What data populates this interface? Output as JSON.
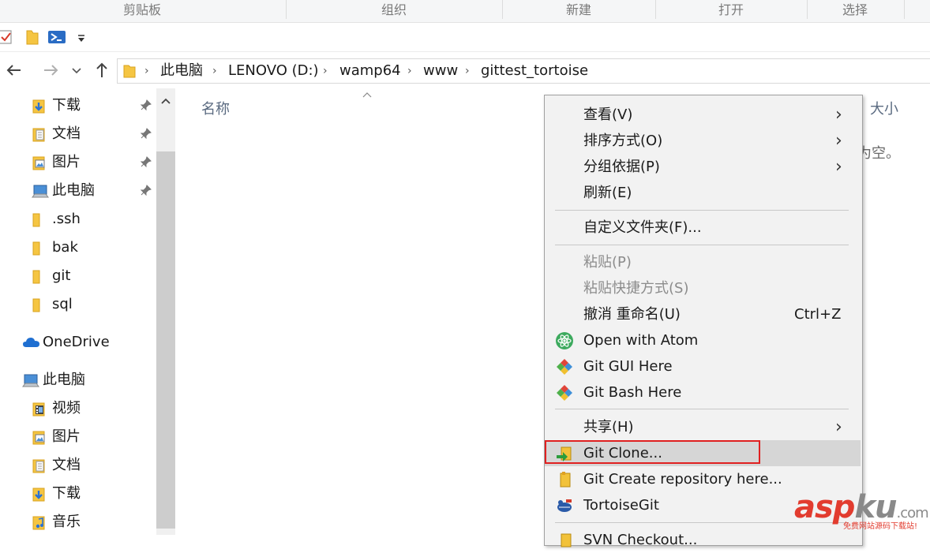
{
  "ribbon": {
    "groups": [
      "剪贴板",
      "组织",
      "新建",
      "打开",
      "选择"
    ]
  },
  "address": {
    "crumbs": [
      "此电脑",
      "LENOVO (D:)",
      "wamp64",
      "www",
      "gittest_tortoise"
    ]
  },
  "sidebar": {
    "quick_access": [
      {
        "label": "下载",
        "icon": "download-folder-icon",
        "pinned": true
      },
      {
        "label": "文档",
        "icon": "documents-folder-icon",
        "pinned": true
      },
      {
        "label": "图片",
        "icon": "pictures-folder-icon",
        "pinned": true
      },
      {
        "label": "此电脑",
        "icon": "this-pc-icon",
        "pinned": true
      },
      {
        "label": ".ssh",
        "icon": "folder-icon",
        "pinned": false
      },
      {
        "label": "bak",
        "icon": "folder-icon",
        "pinned": false
      },
      {
        "label": "git",
        "icon": "folder-icon",
        "pinned": false
      },
      {
        "label": "sql",
        "icon": "folder-icon",
        "pinned": false
      }
    ],
    "onedrive": "OneDrive",
    "this_pc": "此电脑",
    "this_pc_items": [
      {
        "label": "视频",
        "icon": "videos-folder-icon"
      },
      {
        "label": "图片",
        "icon": "pictures-folder-icon"
      },
      {
        "label": "文档",
        "icon": "documents-folder-icon"
      },
      {
        "label": "下载",
        "icon": "download-folder-icon"
      },
      {
        "label": "音乐",
        "icon": "music-folder-icon"
      }
    ]
  },
  "main": {
    "col_name": "名称",
    "col_size": "大小",
    "empty_text": "此文件夹为空。"
  },
  "context_menu": {
    "view": "查看(V)",
    "sort": "排序方式(O)",
    "group": "分组依据(P)",
    "refresh": "刷新(E)",
    "customize": "自定义文件夹(F)...",
    "paste": "粘贴(P)",
    "paste_shortcut": "粘贴快捷方式(S)",
    "undo_rename": "撤消 重命名(U)",
    "undo_shortcut": "Ctrl+Z",
    "open_atom": "Open with Atom",
    "git_gui": "Git GUI Here",
    "git_bash": "Git Bash Here",
    "share": "共享(H)",
    "git_clone": "Git Clone...",
    "git_create": "Git Create repository here...",
    "tortoisegit": "TortoiseGit",
    "svn_checkout": "SVN Checkout..."
  },
  "watermark": {
    "brand_a": "asp",
    "brand_b": "ku",
    "brand_c": ".com",
    "tagline": "免费网站源码下载站!"
  }
}
